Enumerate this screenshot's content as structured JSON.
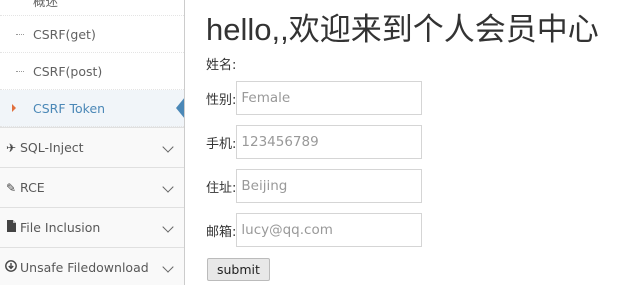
{
  "sidebar": {
    "submenu": [
      {
        "label": "概述"
      },
      {
        "label": "CSRF(get)"
      },
      {
        "label": "CSRF(post)"
      },
      {
        "label": "CSRF Token"
      }
    ],
    "items": [
      {
        "label": "SQL-Inject",
        "icon": "plane-icon"
      },
      {
        "label": "RCE",
        "icon": "pencil-icon"
      },
      {
        "label": "File Inclusion",
        "icon": "file-icon"
      },
      {
        "label": "Unsafe Filedownload",
        "icon": "download-icon"
      }
    ]
  },
  "main": {
    "title": "hello,,欢迎来到个人会员中心",
    "name_label": "姓名:",
    "fields": [
      {
        "label": "性别:",
        "placeholder": "Female"
      },
      {
        "label": "手机:",
        "placeholder": "123456789"
      },
      {
        "label": "住址:",
        "placeholder": "Beijing"
      },
      {
        "label": "邮箱:",
        "placeholder": "lucy@qq.com"
      }
    ],
    "submit_label": "submit"
  },
  "colors": {
    "accent": "#4b88b7",
    "caret": "#e16f3d"
  }
}
